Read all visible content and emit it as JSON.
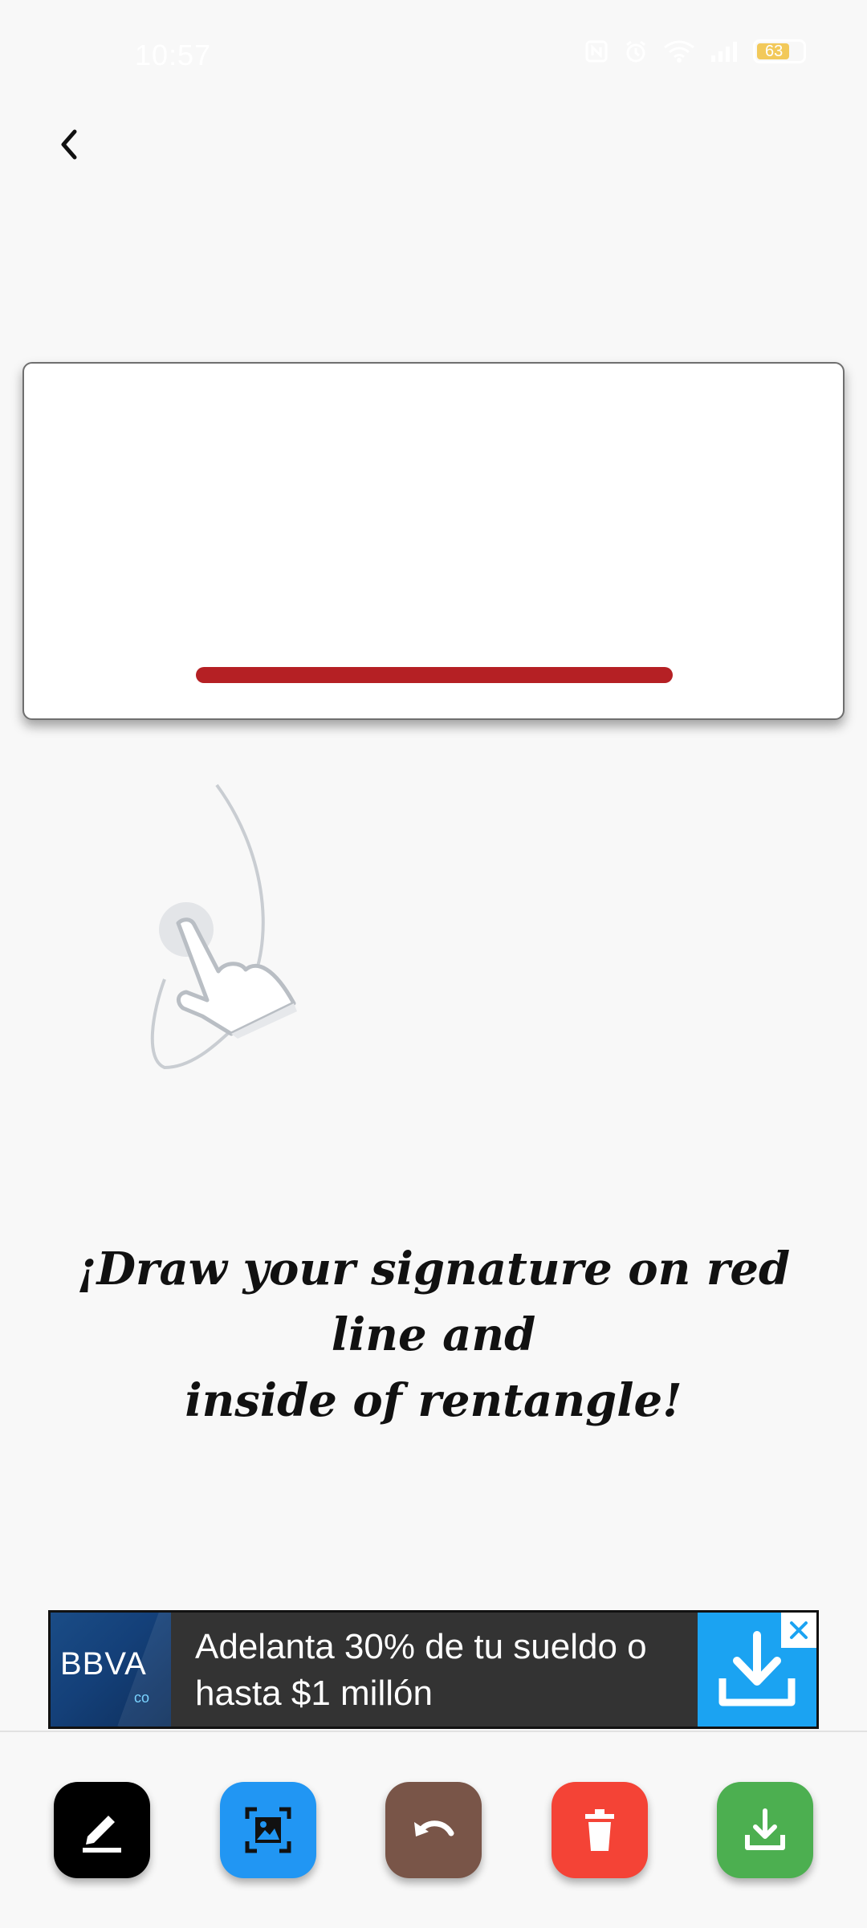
{
  "status_bar": {
    "time": "10:57",
    "battery": "63",
    "icons": [
      "nfc-icon",
      "alarm-icon",
      "wifi-icon",
      "signal-icon",
      "battery-icon"
    ]
  },
  "header": {
    "back_icon": "chevron-left-icon"
  },
  "signature_area": {
    "guide_line_color": "#b52024"
  },
  "instruction": {
    "line1": "¡Draw your signature on red line and",
    "line2": "inside of rentangle!"
  },
  "ad": {
    "logo_text": "BBVA",
    "logo_sub": "co",
    "text": "Adelanta 30% de tu sueldo o hasta $1 millón",
    "download_icon": "download-icon",
    "close_icon": "close-icon"
  },
  "toolbar": {
    "buttons": [
      {
        "icon": "pen-icon",
        "color": "#000000"
      },
      {
        "icon": "image-select-icon",
        "color": "#2196f3"
      },
      {
        "icon": "undo-icon",
        "color": "#795548"
      },
      {
        "icon": "trash-icon",
        "color": "#f44336"
      },
      {
        "icon": "save-download-icon",
        "color": "#4caf50"
      }
    ]
  }
}
